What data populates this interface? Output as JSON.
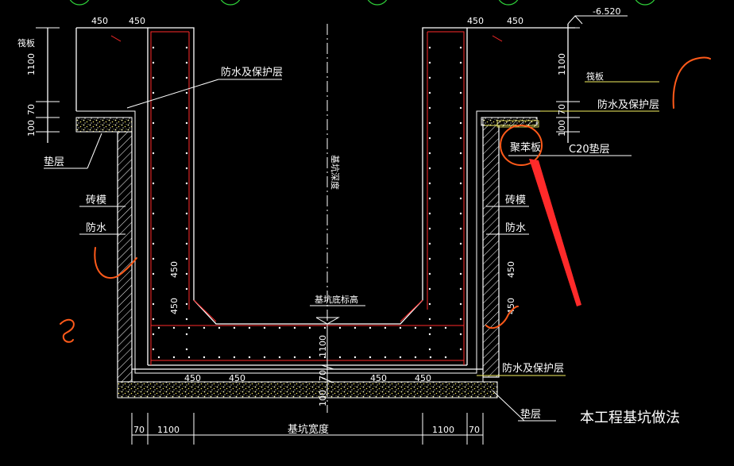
{
  "labels": {
    "elev_top": "-6.520",
    "dim_450": "450",
    "dim_1100": "1100",
    "dim_70": "70",
    "dim_100": "100",
    "floor_slab": "筏板",
    "waterproof_protect": "防水及保护层",
    "cushion_layer": "垫层",
    "brick_mold": "砖模",
    "waterproof": "防水",
    "foundation_depth": "基坑深度",
    "pit_bottom_elev": "基坑底标高",
    "polystyrene_board": "聚苯板",
    "c20_cushion": "C20垫层",
    "pit_width": "基坑宽度",
    "caption": "本工程基坑做法"
  },
  "colors": {
    "background": "#000000",
    "line": "#ffffff",
    "rebar": "#ff2a2a",
    "annotation": "#ff5a1a",
    "grid": "#2fd23a",
    "axis": "#3cb8ff",
    "leader": "#f4f060"
  }
}
